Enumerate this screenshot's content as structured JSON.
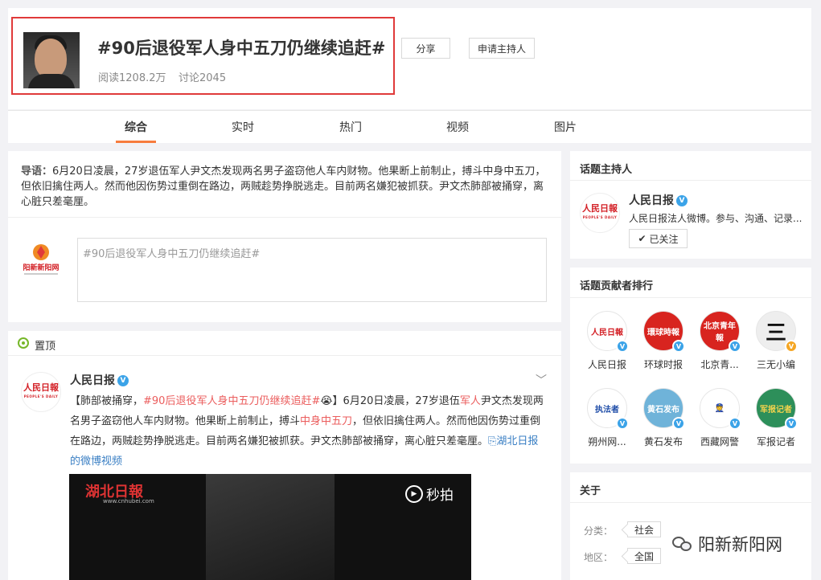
{
  "topic": {
    "title": "#90后退役军人身中五刀仍继续追赶#",
    "read_count": "阅读1208.2万",
    "discuss_count": "讨论2045",
    "share_label": "分享",
    "apply_host_label": "申请主持人"
  },
  "tabs": [
    "综合",
    "实时",
    "热门",
    "视频",
    "图片"
  ],
  "intro": {
    "label": "导语：",
    "text": "6月20日凌晨，27岁退伍军人尹文杰发现两名男子盗窃他人车内财物。他果断上前制止，搏斗中身中五刀，但依旧擒住两人。然而他因伤势过重倒在路边，两贼趁势挣脱逃走。目前两名嫌犯被抓获。尹文杰肺部被捅穿，离心脏只差毫厘。"
  },
  "compose": {
    "value": "#90后退役军人身中五刀仍继续追赶#",
    "poster_logo_text": "阳新新阳网"
  },
  "pinned": {
    "label": "置顶",
    "author": "人民日报",
    "text_parts": {
      "p1": "【肺部被捅穿，",
      "p2": "#90后退役军人身中五刀仍继续追赶#",
      "p3": "😭",
      "p4": "】6月20日凌晨，27岁退伍",
      "p5": "军人",
      "p6": "尹文杰发现两名男子盗窃他人车内财物。他果断上前制止，搏斗",
      "p7": "中身中五刀",
      "p8": "，但依旧擒住两人。然而他因伤势过重倒在路边，两贼趁势挣脱逃走。目前两名嫌犯被抓获。尹文杰肺部被捅穿，离心脏只差毫厘。",
      "p9": "⎘湖北日报的微博视频"
    },
    "video_brand": "湖北日報",
    "video_url": "www.cnhubei.com",
    "video_platform": "秒拍"
  },
  "host": {
    "title": "话题主持人",
    "name": "人民日报",
    "desc": "人民日报法人微博。参与、沟通、记录...",
    "follow_label": "已关注"
  },
  "ranking": {
    "title": "话题贡献者排行",
    "items": [
      {
        "name": "人民日报",
        "avatar_text": "人民日報",
        "color": "#ffffff",
        "text_color": "#d31f25",
        "gold": false
      },
      {
        "name": "环球时报",
        "avatar_text": "環球時報",
        "color": "#d8241f",
        "text_color": "#ffffff",
        "gold": false
      },
      {
        "name": "北京青...",
        "avatar_text": "北京青年報",
        "color": "#d8241f",
        "text_color": "#ffffff",
        "gold": false
      },
      {
        "name": "三无小编",
        "avatar_text": "三",
        "color": "#eeeeee",
        "text_color": "#111111",
        "gold": true
      },
      {
        "name": "朔州网...",
        "avatar_text": "执法者",
        "color": "#ffffff",
        "text_color": "#1f4da8",
        "gold": false
      },
      {
        "name": "黄石发布",
        "avatar_text": "黄石发布",
        "color": "#6fb3d9",
        "text_color": "#ffffff",
        "gold": false
      },
      {
        "name": "西藏网警",
        "avatar_text": "👮",
        "color": "#ffffff",
        "text_color": "#1f4da8",
        "gold": false
      },
      {
        "name": "军报记者",
        "avatar_text": "军报记者",
        "color": "#2d8f5a",
        "text_color": "#f2d34d",
        "gold": false
      }
    ]
  },
  "about": {
    "title": "关于",
    "category_key": "分类：",
    "category_value": "社会",
    "region_key": "地区：",
    "region_value": "全国"
  },
  "watermark": "阳新新阳网",
  "colors": {
    "accent": "#f77c3d",
    "link": "#3a7fc4",
    "highlight_red": "#eb5d5d",
    "highlight_box": "#e03a3a"
  }
}
